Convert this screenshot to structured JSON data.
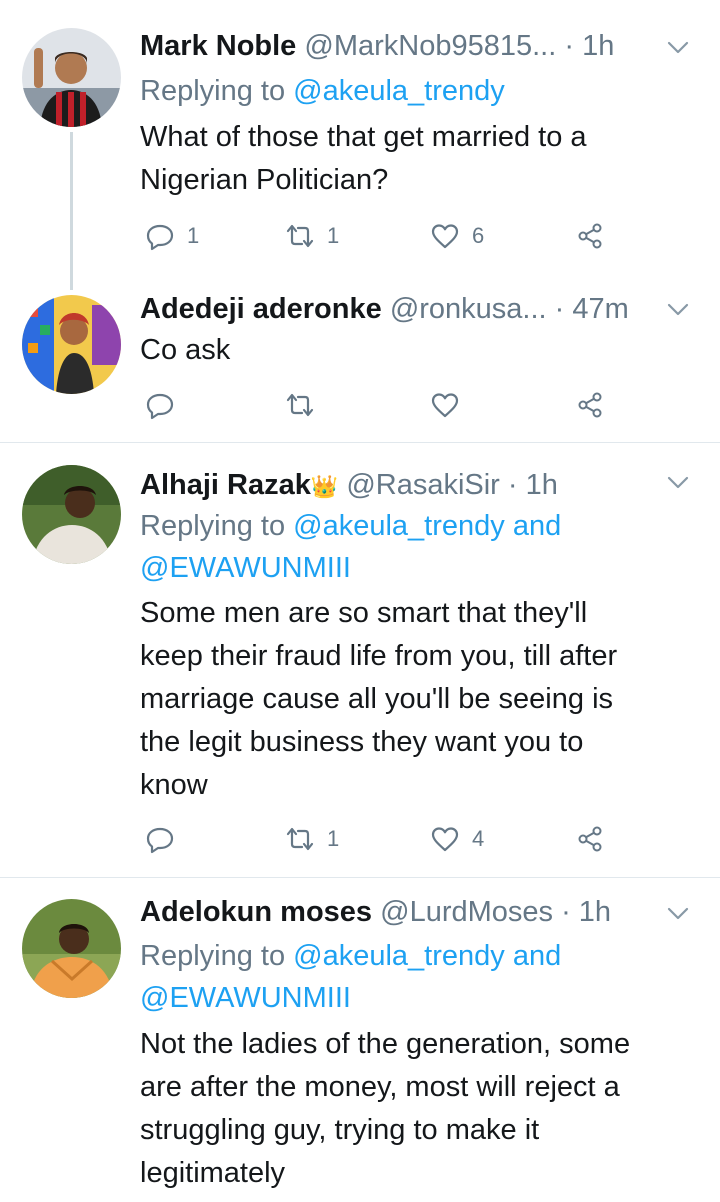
{
  "tweets": [
    {
      "name": "Mark Noble",
      "handle": "@MarkNob95815...",
      "time": "· 1h",
      "replying_prefix": "Replying to ",
      "replying_mentions": "@akeula_trendy",
      "replying_line2": "",
      "text_lines": [
        "What of those that get married to a",
        "Nigerian Politician?"
      ],
      "reply_count": "1",
      "retweet_count": "1",
      "like_count": "6"
    },
    {
      "name": "Adedeji aderonke",
      "handle": "@ronkusa...",
      "time": "· 47m",
      "text_lines": [
        "Co ask"
      ],
      "reply_count": "",
      "retweet_count": "",
      "like_count": ""
    },
    {
      "name": "Alhaji Razak",
      "crown": "👑",
      "handle": "@RasakiSir",
      "time": "· 1h",
      "replying_prefix": "Replying to ",
      "replying_mentions": "@akeula_trendy and",
      "replying_line2": "@EWAWUNMIII",
      "text_lines": [
        "Some men are so smart that they'll",
        "keep their fraud life from you, till after",
        "marriage cause all you'll be seeing is",
        "the legit business they want you to",
        "know"
      ],
      "reply_count": "",
      "retweet_count": "1",
      "like_count": "4"
    },
    {
      "name": "Adelokun moses",
      "handle": "@LurdMoses",
      "time": "· 1h",
      "replying_prefix": "Replying to ",
      "replying_mentions": "@akeula_trendy and",
      "replying_line2": "@EWAWUNMIII",
      "text_lines": [
        "Not the ladies of the generation, some",
        "are after the money, most will reject a",
        "struggling guy, trying to make it",
        "legitimately"
      ]
    }
  ],
  "colors": {
    "text": "#14171a",
    "secondary": "#657786",
    "link": "#1da1f2",
    "divider": "#e1e8ed"
  },
  "icons": [
    "reply-icon",
    "retweet-icon",
    "like-icon",
    "share-icon",
    "chevron-down-icon"
  ]
}
